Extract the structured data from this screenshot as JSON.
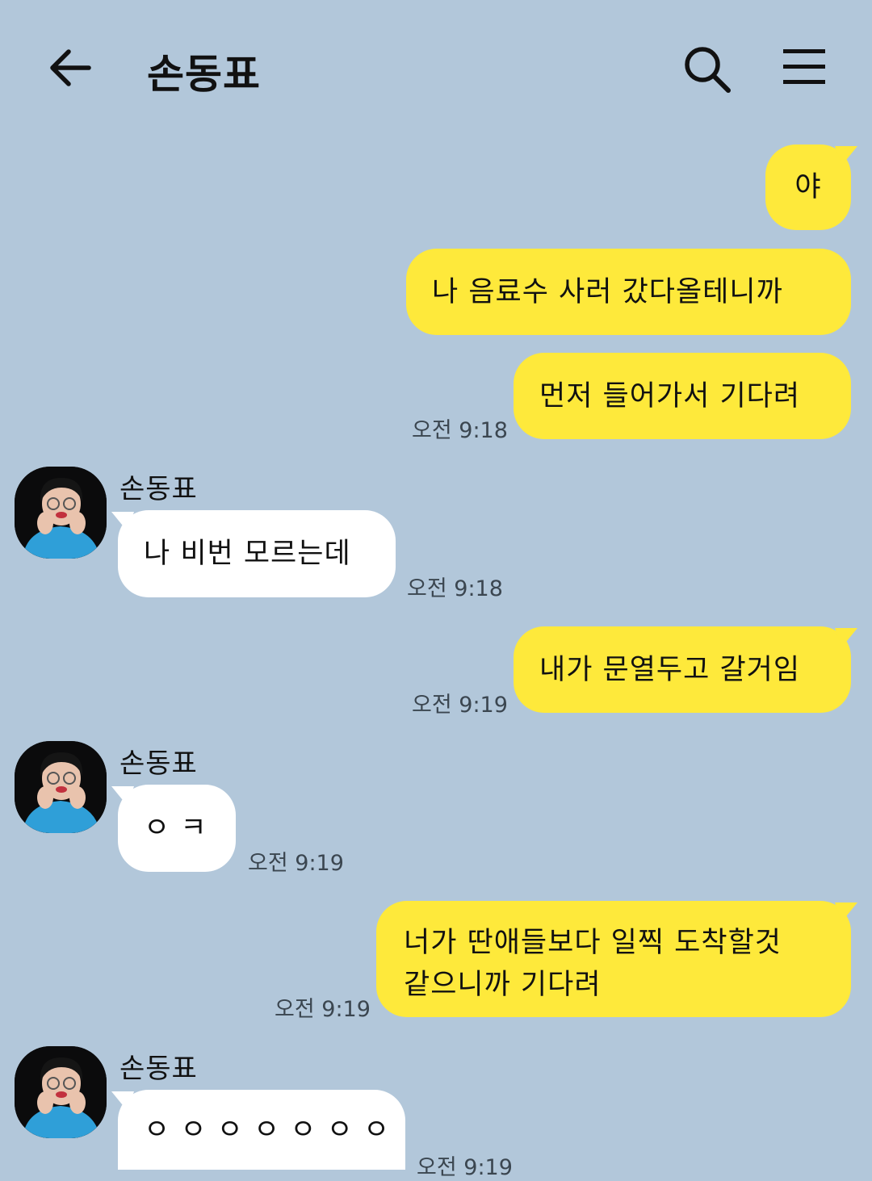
{
  "header": {
    "title": "손동표"
  },
  "messages": [
    {
      "text": "야",
      "time": ""
    },
    {
      "text": "나 음료수 사러 갔다올테니까",
      "time": ""
    },
    {
      "text": "먼저 들어가서 기다려",
      "time": "오전 9:18"
    },
    {
      "sender": "손동표",
      "text": "나 비번 모르는데",
      "time": "오전 9:18"
    },
    {
      "text": "내가 문열두고 갈거임",
      "time": "오전 9:19"
    },
    {
      "sender": "손동표",
      "text": "ㅇ ㅋ",
      "time": "오전 9:19"
    },
    {
      "text_line1": "너가 딴애들보다 일찍 도착할것",
      "text_line2": "같으니까 기다려",
      "time": "오전 9:19"
    },
    {
      "sender": "손동표",
      "text": "ㅇ ㅇ ㅇ ㅇ ㅇ ㅇ ㅇ",
      "time": "오전 9:19"
    }
  ],
  "colors": {
    "background": "#b2c7da",
    "my_bubble": "#fee93b",
    "their_bubble": "#ffffff"
  },
  "icons": {
    "back": "arrow-left-icon",
    "search": "search-icon",
    "menu": "hamburger-menu-icon",
    "avatar": "profile-photo"
  }
}
